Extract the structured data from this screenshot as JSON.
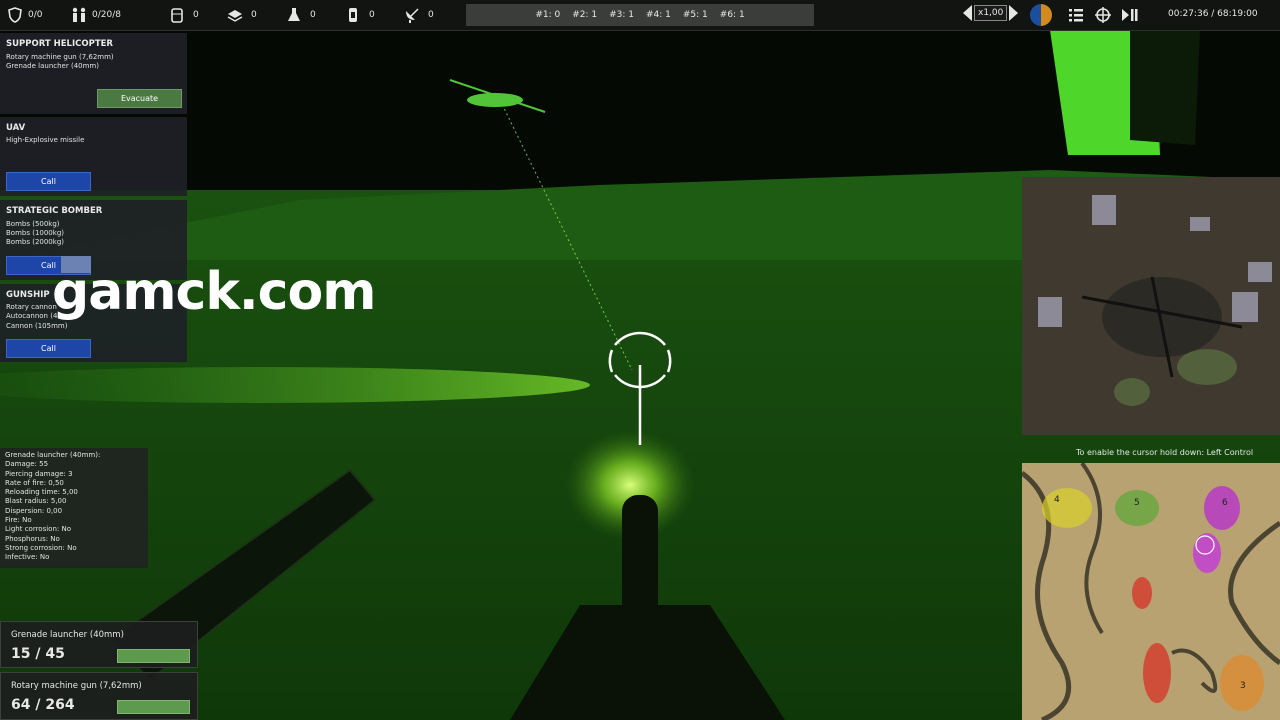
{
  "resources": [
    {
      "name": "shield-icon",
      "value": "0/0"
    },
    {
      "name": "soldiers-icon",
      "value": "0/20/8"
    },
    {
      "name": "barrel-icon",
      "value": "0"
    },
    {
      "name": "layers-icon",
      "value": "0"
    },
    {
      "name": "flask-icon",
      "value": "0"
    },
    {
      "name": "canister-icon",
      "value": "0"
    },
    {
      "name": "satellite-dish-icon",
      "value": "0"
    }
  ],
  "counters": [
    "#1: 0",
    "#2: 1",
    "#3: 1",
    "#4: 1",
    "#5: 1",
    "#6: 1"
  ],
  "speed": "x1,00",
  "clock": "00:27:36 / 68:19:00",
  "support": [
    {
      "title": "SUPPORT HELICOPTER",
      "lines": [
        "Rotary machine gun (7,62mm)",
        "Grenade launcher (40mm)"
      ],
      "button": "Evacuate"
    },
    {
      "title": "UAV",
      "lines": [
        "High-Explosive missile"
      ],
      "button": "Call"
    },
    {
      "title": "STRATEGIC BOMBER",
      "lines": [
        "Bombs (500kg)",
        "Bombs (1000kg)",
        "Bombs (2000kg)"
      ],
      "button": "Call",
      "cooldown": 0.36
    },
    {
      "title": "GUNSHIP",
      "lines": [
        "Rotary cannon",
        "Autocannon (40mm)",
        "Cannon (105mm)"
      ],
      "button": "Call"
    }
  ],
  "weapon_stats": [
    "Grenade launcher (40mm):",
    "Damage: 55",
    "Piercing damage: 3",
    "Rate of fire: 0,50",
    "Reloading time: 5,00",
    "Blast radius: 5,00",
    "Dispersion: 0,00",
    "Fire: No",
    "Light corrosion: No",
    "Phosphorus: No",
    "Strong corrosion: No",
    "Infective: No"
  ],
  "weapons": [
    {
      "name": "Grenade launcher (40mm)",
      "ammo": "15 / 45",
      "fill": 1.0
    },
    {
      "name": "Rotary machine gun (7,62mm)",
      "ammo": "64 / 264",
      "fill": 1.0
    }
  ],
  "cursor_hint": "To enable the cursor hold down:  Left Control",
  "minimap_labels": [
    "4",
    "5",
    "6",
    "3"
  ],
  "watermark": "gamck.com",
  "colors": {
    "nightvision": "#2f8a1c",
    "panel": "#1e2126",
    "button_blue": "#1d46a8",
    "button_green": "#4a7a42"
  }
}
